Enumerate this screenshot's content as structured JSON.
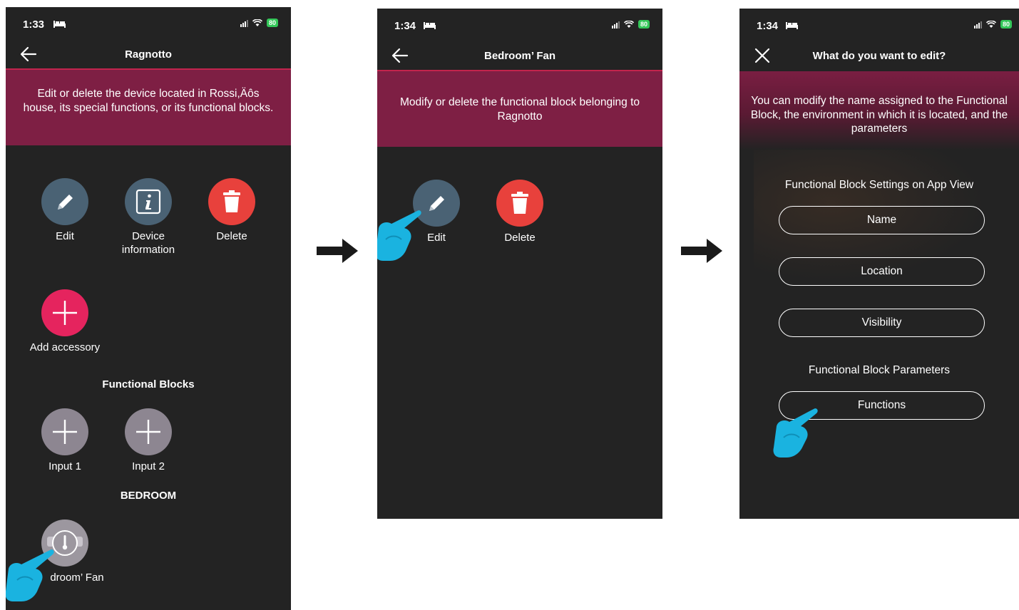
{
  "screens": [
    {
      "status": {
        "time": "1:33",
        "battery": "80"
      },
      "title": "Ragnotto",
      "banner": "Edit or delete the device located in Rossi,Äôs house, its special functions, or its functional blocks.",
      "actions": {
        "edit": "Edit",
        "device_info": "Device information",
        "delete": "Delete",
        "add_accessory": "Add accessory"
      },
      "functional_blocks_heading": "Functional Blocks",
      "inputs": [
        "Input 1",
        "Input 2"
      ],
      "room_heading": "BEDROOM",
      "fan_label": "droom’ Fan"
    },
    {
      "status": {
        "time": "1:34",
        "battery": "80"
      },
      "title": "Bedroom’ Fan",
      "banner": "Modify or delete the functional block belonging to Ragnotto",
      "actions": {
        "edit": "Edit",
        "delete": "Delete"
      }
    },
    {
      "status": {
        "time": "1:34",
        "battery": "80"
      },
      "title": "What do you want to edit?",
      "banner": "You can modify the name assigned to the Functional Block, the environment in which it is located, and the parameters",
      "settings_heading": "Functional Block Settings on App View",
      "settings_buttons": [
        "Name",
        "Location",
        "Visibility"
      ],
      "parameters_heading": "Functional Block Parameters",
      "parameters_buttons": [
        "Functions"
      ]
    }
  ],
  "colors": {
    "background": "#232323",
    "banner": "#7e1f44",
    "accent_line": "#c2244d",
    "delete": "#e8413c",
    "add": "#e5245e",
    "hand_pointer": "#1ab3e0"
  }
}
